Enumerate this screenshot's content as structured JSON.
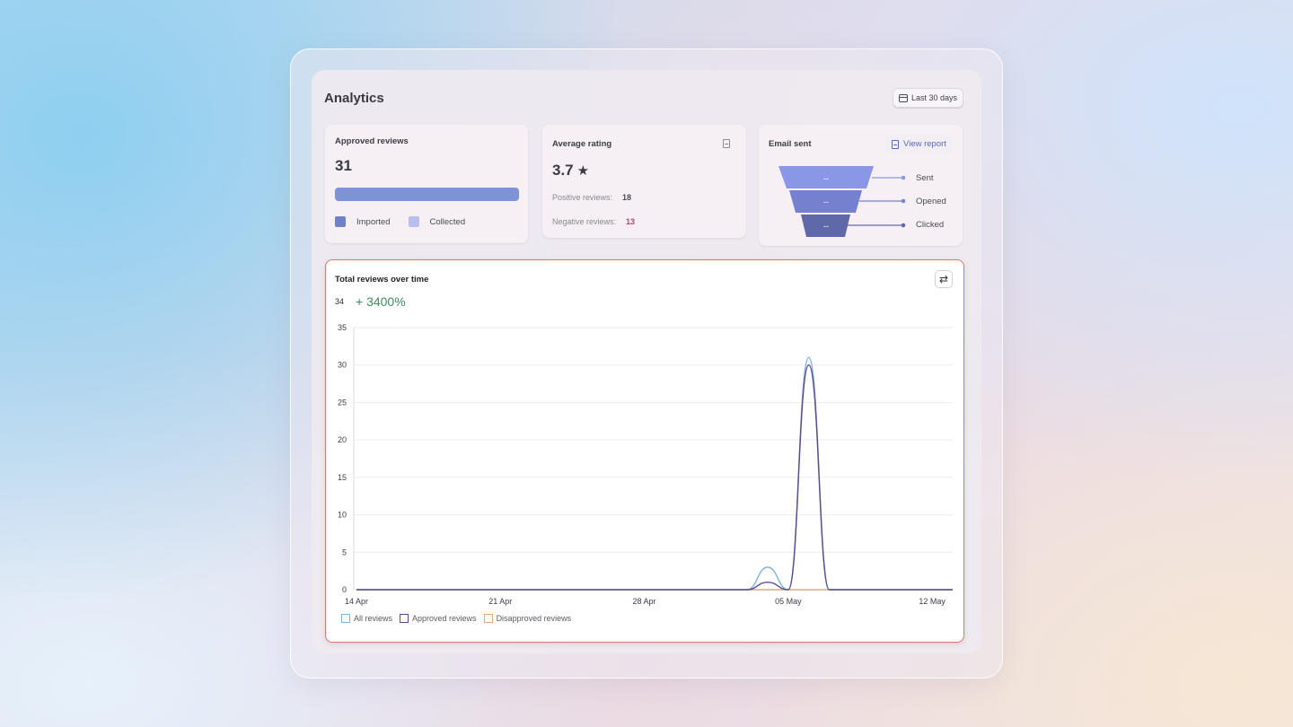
{
  "page": {
    "title": "Analytics",
    "date_range": "Last 30 days"
  },
  "approved_reviews": {
    "title": "Approved reviews",
    "value": "31",
    "legend": [
      {
        "label": "Imported",
        "color": "#6f82c9"
      },
      {
        "label": "Collected",
        "color": "#b9bdf0"
      }
    ]
  },
  "average_rating": {
    "title": "Average rating",
    "value": "3.7",
    "positive_label": "Positive reviews:",
    "positive_value": "18",
    "negative_label": "Negative reviews:",
    "negative_value": "13"
  },
  "email_sent": {
    "title": "Email sent",
    "view_report": "View report",
    "stages": [
      {
        "label": "Sent",
        "value": "--",
        "color": "#8a97e6"
      },
      {
        "label": "Opened",
        "value": "--",
        "color": "#7581cf"
      },
      {
        "label": "Clicked",
        "value": "--",
        "color": "#5f69aa"
      }
    ]
  },
  "chart_card": {
    "title": "Total reviews over time",
    "total": "34",
    "change": "+ 3400%"
  },
  "chart_data": {
    "type": "line",
    "title": "Total reviews over time",
    "x": [
      "14 Apr",
      "15 Apr",
      "16 Apr",
      "17 Apr",
      "18 Apr",
      "19 Apr",
      "20 Apr",
      "21 Apr",
      "22 Apr",
      "23 Apr",
      "24 Apr",
      "25 Apr",
      "26 Apr",
      "27 Apr",
      "28 Apr",
      "29 Apr",
      "30 Apr",
      "01 May",
      "02 May",
      "03 May",
      "04 May",
      "05 May",
      "06 May",
      "07 May",
      "08 May",
      "09 May",
      "10 May",
      "11 May",
      "12 May",
      "13 May"
    ],
    "xticks": [
      "14 Apr",
      "21 Apr",
      "28 Apr",
      "05 May",
      "12 May"
    ],
    "ylim": [
      0,
      35
    ],
    "yticks": [
      0,
      5,
      10,
      15,
      20,
      25,
      30,
      35
    ],
    "grid": true,
    "legend_position": "bottom-left",
    "series": [
      {
        "name": "All reviews",
        "color": "#7fb3dd",
        "values": [
          0,
          0,
          0,
          0,
          0,
          0,
          0,
          0,
          0,
          0,
          0,
          0,
          0,
          0,
          0,
          0,
          0,
          0,
          0,
          0,
          3,
          0,
          31,
          0,
          0,
          0,
          0,
          0,
          0,
          0
        ]
      },
      {
        "name": "Approved reviews",
        "color": "#5b4a8f",
        "values": [
          0,
          0,
          0,
          0,
          0,
          0,
          0,
          0,
          0,
          0,
          0,
          0,
          0,
          0,
          0,
          0,
          0,
          0,
          0,
          0,
          1,
          0,
          30,
          0,
          0,
          0,
          0,
          0,
          0,
          0
        ]
      },
      {
        "name": "Disapproved reviews",
        "color": "#e6a874",
        "values": [
          0,
          0,
          0,
          0,
          0,
          0,
          0,
          0,
          0,
          0,
          0,
          0,
          0,
          0,
          0,
          0,
          0,
          0,
          0,
          0,
          0,
          0,
          0,
          0,
          0,
          0,
          0,
          0,
          0,
          0
        ]
      }
    ]
  }
}
